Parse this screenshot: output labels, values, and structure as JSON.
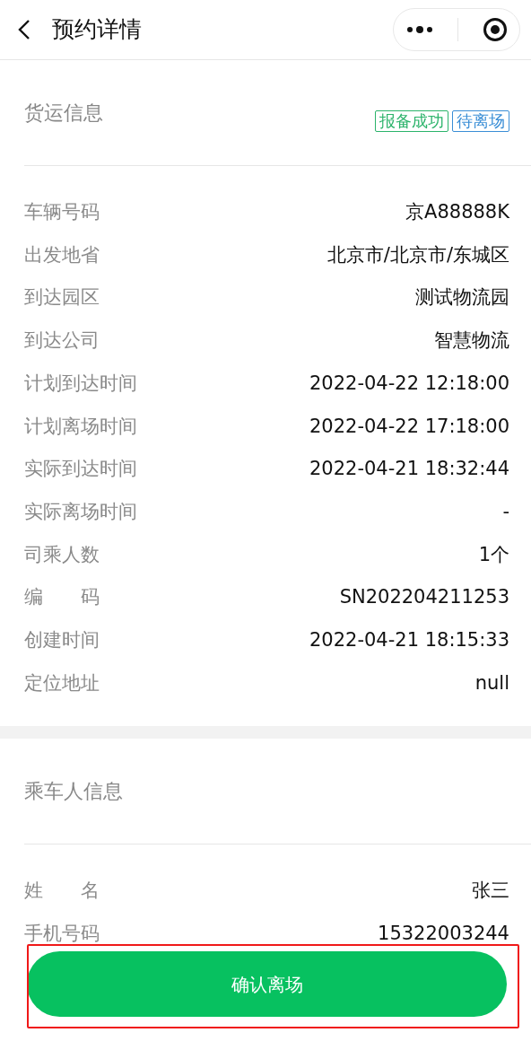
{
  "header": {
    "title": "预约详情"
  },
  "sections": [
    {
      "title": "货运信息",
      "tags": [
        {
          "label": "报备成功",
          "color": "#2bb36a"
        },
        {
          "label": "待离场",
          "color": "#3a8ed6"
        }
      ],
      "rows": [
        {
          "label": "车辆号码",
          "value": "京A88888K"
        },
        {
          "label": "出发地省",
          "value": "北京市/北京市/东城区"
        },
        {
          "label": "到达园区",
          "value": "测试物流园"
        },
        {
          "label": "到达公司",
          "value": "智慧物流"
        },
        {
          "label": "计划到达时间",
          "value": "2022-04-22 12:18:00"
        },
        {
          "label": "计划离场时间",
          "value": "2022-04-22 17:18:00"
        },
        {
          "label": "实际到达时间",
          "value": "2022-04-21 18:32:44"
        },
        {
          "label": "实际离场时间",
          "value": "-"
        },
        {
          "label": "司乘人数",
          "value": "1个"
        },
        {
          "label": "编　　码",
          "value": "SN202204211253"
        },
        {
          "label": "创建时间",
          "value": "2022-04-21 18:15:33"
        },
        {
          "label": "定位地址",
          "value": "null"
        }
      ]
    },
    {
      "title": "乘车人信息",
      "rows": [
        {
          "label": "姓　　名",
          "value": "张三"
        },
        {
          "label": "手机号码",
          "value": "15322003244"
        }
      ]
    }
  ],
  "footer": {
    "button": "确认离场"
  }
}
